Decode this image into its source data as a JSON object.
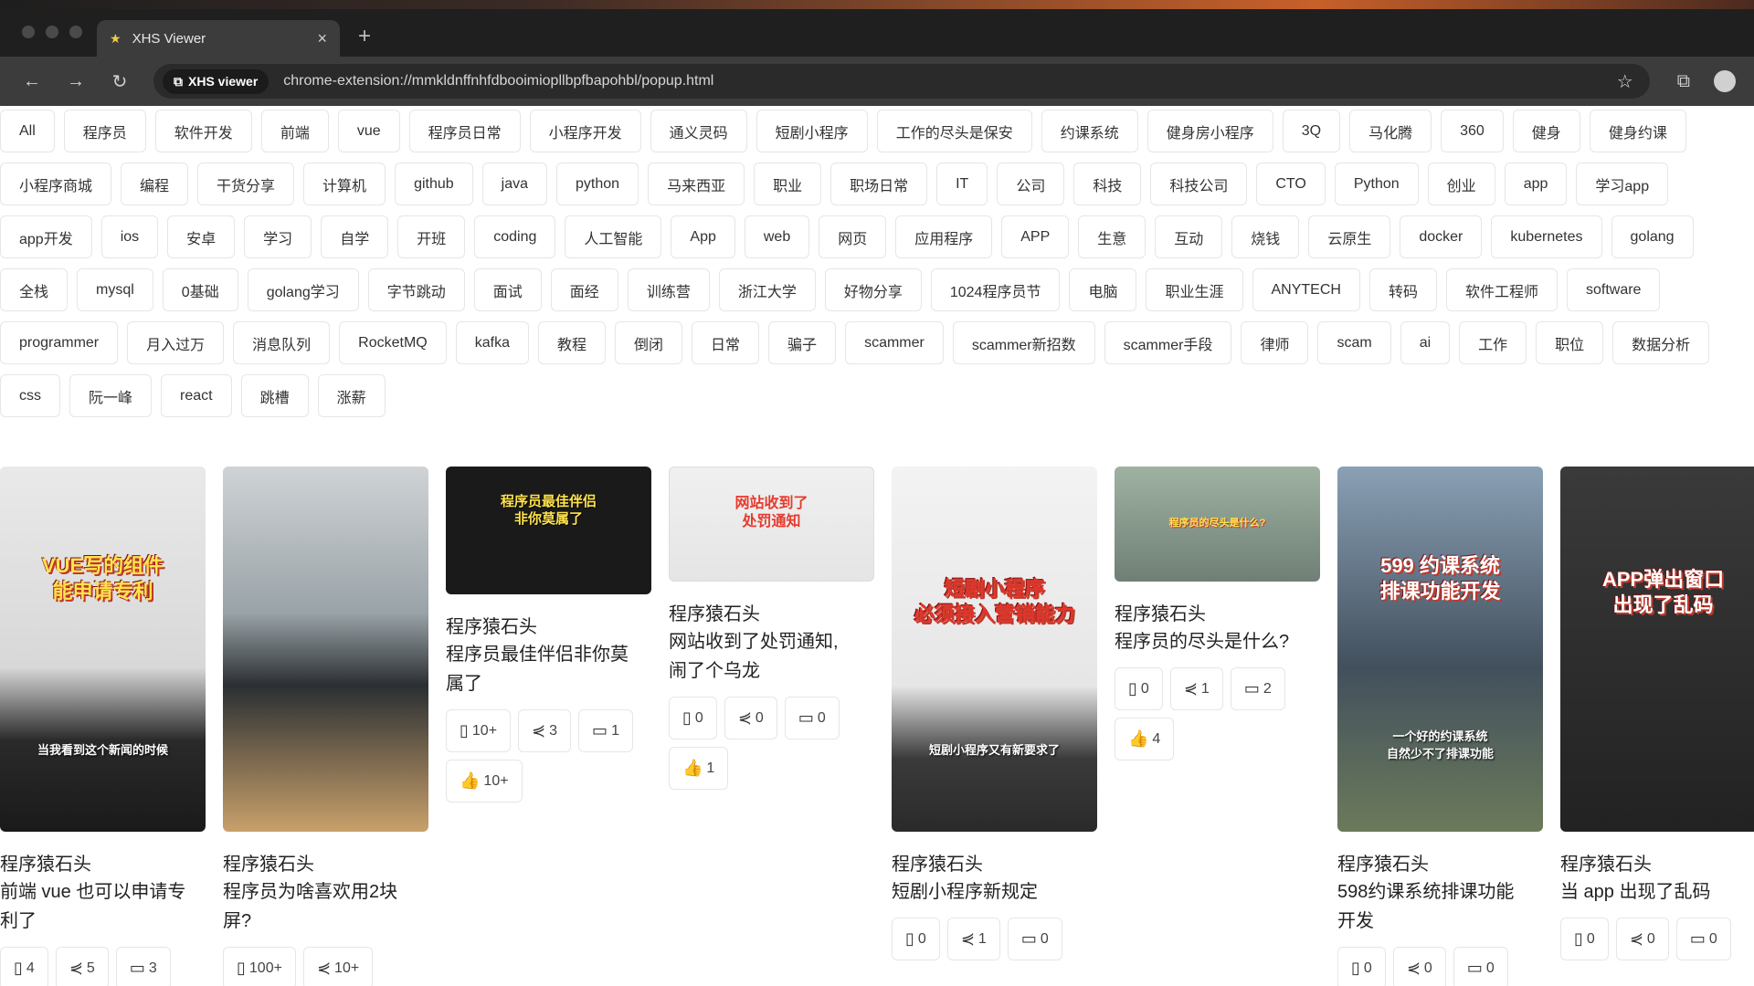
{
  "browser": {
    "tab_title": "XHS Viewer",
    "extension_chip": "XHS viewer",
    "url": "chrome-extension://mmkldnffnhfdbooimiopllbpfbapohbl/popup.html"
  },
  "tags": [
    "All",
    "程序员",
    "软件开发",
    "前端",
    "vue",
    "程序员日常",
    "小程序开发",
    "通义灵码",
    "短剧小程序",
    "工作的尽头是保安",
    "约课系统",
    "健身房小程序",
    "3Q",
    "马化腾",
    "360",
    "健身",
    "健身约课",
    "小程序商城",
    "编程",
    "干货分享",
    "计算机",
    "github",
    "java",
    "python",
    "马来西亚",
    "职业",
    "职场日常",
    "IT",
    "公司",
    "科技",
    "科技公司",
    "CTO",
    "Python",
    "创业",
    "app",
    "学习app",
    "app开发",
    "ios",
    "安卓",
    "学习",
    "自学",
    "开班",
    "coding",
    "人工智能",
    "App",
    "web",
    "网页",
    "应用程序",
    "APP",
    "生意",
    "互动",
    "烧钱",
    "云原生",
    "docker",
    "kubernetes",
    "golang",
    "全栈",
    "mysql",
    "0基础",
    "golang学习",
    "字节跳动",
    "面试",
    "面经",
    "训练营",
    "浙江大学",
    "好物分享",
    "1024程序员节",
    "电脑",
    "职业生涯",
    "ANYTECH",
    "转码",
    "软件工程师",
    "software",
    "programmer",
    "月入过万",
    "消息队列",
    "RocketMQ",
    "kafka",
    "教程",
    "倒闭",
    "日常",
    "骗子",
    "scammer",
    "scammer新招数",
    "scammer手段",
    "律师",
    "scam",
    "ai",
    "工作",
    "职位",
    "数据分析",
    "css",
    "阮一峰",
    "react",
    "跳槽",
    "涨薪"
  ],
  "cards": [
    {
      "author": "程序猿石头",
      "title_lines": [
        "前端 vue 也可以申请专",
        "利了"
      ],
      "caption": "VUE写的组件\n能申请专利",
      "sub": "当我看到这个新闻的时候",
      "stats": [
        {
          "icon": "bookmark-icon",
          "glyph": "▯",
          "value": "4"
        },
        {
          "icon": "share-icon",
          "glyph": "⋞",
          "value": "5"
        },
        {
          "icon": "comment-icon",
          "glyph": "▭",
          "value": "3"
        }
      ]
    },
    {
      "author": "程序猿石头",
      "title_lines": [
        "程序员为啥喜欢用2块",
        "屏?"
      ],
      "caption": "",
      "sub": "",
      "stats": [
        {
          "icon": "bookmark-icon",
          "glyph": "▯",
          "value": "100+"
        },
        {
          "icon": "share-icon",
          "glyph": "⋞",
          "value": "10+"
        }
      ]
    },
    {
      "author": "程序猿石头",
      "title_lines": [
        "程序员最佳伴侣非你莫",
        "属了"
      ],
      "caption": "程序员最佳伴侣\n非你莫属了",
      "sub": "",
      "stats": [
        {
          "icon": "bookmark-icon",
          "glyph": "▯",
          "value": "10+"
        },
        {
          "icon": "share-icon",
          "glyph": "⋞",
          "value": "3"
        },
        {
          "icon": "comment-icon",
          "glyph": "▭",
          "value": "1"
        },
        {
          "icon": "like-icon",
          "glyph": "👍",
          "value": "10+"
        }
      ]
    },
    {
      "author": "程序猿石头",
      "title_lines": [
        "网站收到了处罚通知,",
        "闹了个乌龙"
      ],
      "caption": "网站收到了\n处罚通知",
      "sub": "",
      "stats": [
        {
          "icon": "bookmark-icon",
          "glyph": "▯",
          "value": "0"
        },
        {
          "icon": "share-icon",
          "glyph": "⋞",
          "value": "0"
        },
        {
          "icon": "comment-icon",
          "glyph": "▭",
          "value": "0"
        },
        {
          "icon": "like-icon",
          "glyph": "👍",
          "value": "1"
        }
      ]
    },
    {
      "author": "程序猿石头",
      "title_lines": [
        "短剧小程序新规定"
      ],
      "caption": "短剧小程序\n必须接入营销能力",
      "sub": "短剧小程序又有新要求了",
      "stats": [
        {
          "icon": "bookmark-icon",
          "glyph": "▯",
          "value": "0"
        },
        {
          "icon": "share-icon",
          "glyph": "⋞",
          "value": "1"
        },
        {
          "icon": "comment-icon",
          "glyph": "▭",
          "value": "0"
        }
      ]
    },
    {
      "author": "程序猿石头",
      "title_lines": [
        "程序员的尽头是什么?"
      ],
      "caption": "程序员的尽头是什么?",
      "sub": "",
      "stats": [
        {
          "icon": "bookmark-icon",
          "glyph": "▯",
          "value": "0"
        },
        {
          "icon": "share-icon",
          "glyph": "⋞",
          "value": "1"
        },
        {
          "icon": "comment-icon",
          "glyph": "▭",
          "value": "2"
        },
        {
          "icon": "like-icon",
          "glyph": "👍",
          "value": "4"
        }
      ]
    },
    {
      "author": "程序猿石头",
      "title_lines": [
        "598约课系统排课功能",
        "开发"
      ],
      "caption": "599 约课系统\n排课功能开发",
      "sub": "一个好的约课系统\n自然少不了排课功能",
      "stats": [
        {
          "icon": "bookmark-icon",
          "glyph": "▯",
          "value": "0"
        },
        {
          "icon": "share-icon",
          "glyph": "⋞",
          "value": "0"
        },
        {
          "icon": "comment-icon",
          "glyph": "▭",
          "value": "0"
        }
      ]
    },
    {
      "author": "程序猿石头",
      "title_lines": [
        "当 app 出现了乱码"
      ],
      "caption": "APP弹出窗口\n出现了乱码",
      "sub": "",
      "stats": [
        {
          "icon": "bookmark-icon",
          "glyph": "▯",
          "value": "0"
        },
        {
          "icon": "share-icon",
          "glyph": "⋞",
          "value": "0"
        },
        {
          "icon": "comment-icon",
          "glyph": "▭",
          "value": "0"
        }
      ]
    }
  ]
}
